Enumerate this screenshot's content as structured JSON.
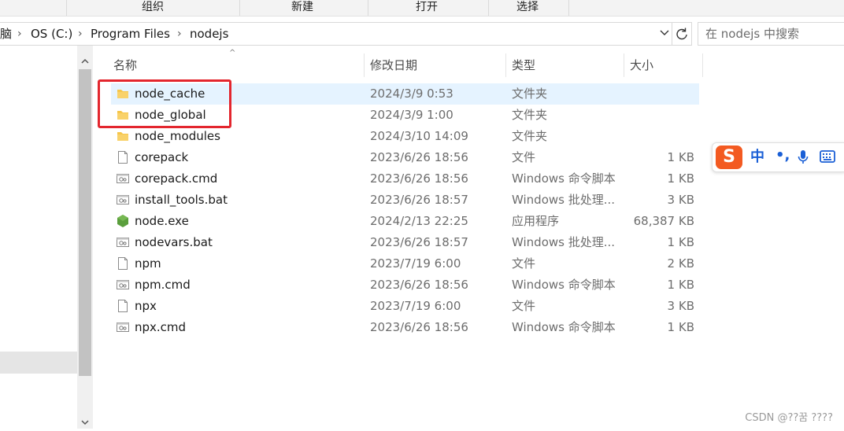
{
  "ribbon": {
    "groups": [
      "组织",
      "新建",
      "打开",
      "选择"
    ]
  },
  "address": {
    "crumbs": [
      "脑",
      "OS (C:)",
      "Program Files",
      "nodejs"
    ],
    "search_placeholder": "在 nodejs 中搜索"
  },
  "columns": {
    "name": "名称",
    "date": "修改日期",
    "type": "类型",
    "size": "大小"
  },
  "files": [
    {
      "name": "node_cache",
      "date": "2024/3/9 0:53",
      "type": "文件夹",
      "size": "",
      "icon": "folder-icon"
    },
    {
      "name": "node_global",
      "date": "2024/3/9 1:00",
      "type": "文件夹",
      "size": "",
      "icon": "folder-icon"
    },
    {
      "name": "node_modules",
      "date": "2024/3/10 14:09",
      "type": "文件夹",
      "size": "",
      "icon": "folder-icon"
    },
    {
      "name": "corepack",
      "date": "2023/6/26 18:56",
      "type": "文件",
      "size": "1 KB",
      "icon": "file-icon"
    },
    {
      "name": "corepack.cmd",
      "date": "2023/6/26 18:56",
      "type": "Windows 命令脚本",
      "size": "1 KB",
      "icon": "script-icon"
    },
    {
      "name": "install_tools.bat",
      "date": "2023/6/26 18:57",
      "type": "Windows 批处理...",
      "size": "3 KB",
      "icon": "script-icon"
    },
    {
      "name": "node.exe",
      "date": "2024/2/13 22:25",
      "type": "应用程序",
      "size": "68,387 KB",
      "icon": "nodejs-icon"
    },
    {
      "name": "nodevars.bat",
      "date": "2023/6/26 18:57",
      "type": "Windows 批处理...",
      "size": "1 KB",
      "icon": "script-icon"
    },
    {
      "name": "npm",
      "date": "2023/7/19 6:00",
      "type": "文件",
      "size": "2 KB",
      "icon": "file-icon"
    },
    {
      "name": "npm.cmd",
      "date": "2023/6/26 18:56",
      "type": "Windows 命令脚本",
      "size": "1 KB",
      "icon": "script-icon"
    },
    {
      "name": "npx",
      "date": "2023/7/19 6:00",
      "type": "文件",
      "size": "3 KB",
      "icon": "file-icon"
    },
    {
      "name": "npx.cmd",
      "date": "2023/6/26 18:56",
      "type": "Windows 命令脚本",
      "size": "1 KB",
      "icon": "script-icon"
    }
  ],
  "ime": {
    "logo": "S",
    "mode": "中",
    "punct": "•,"
  },
  "watermark": "CSDN @??꿈 ????",
  "colors": {
    "highlight_box": "#e3262e",
    "row_hover": "#e5f3ff",
    "folder": "#f6c64b",
    "node_green": "#5a9e3d",
    "ime_orange": "#f35a21"
  }
}
